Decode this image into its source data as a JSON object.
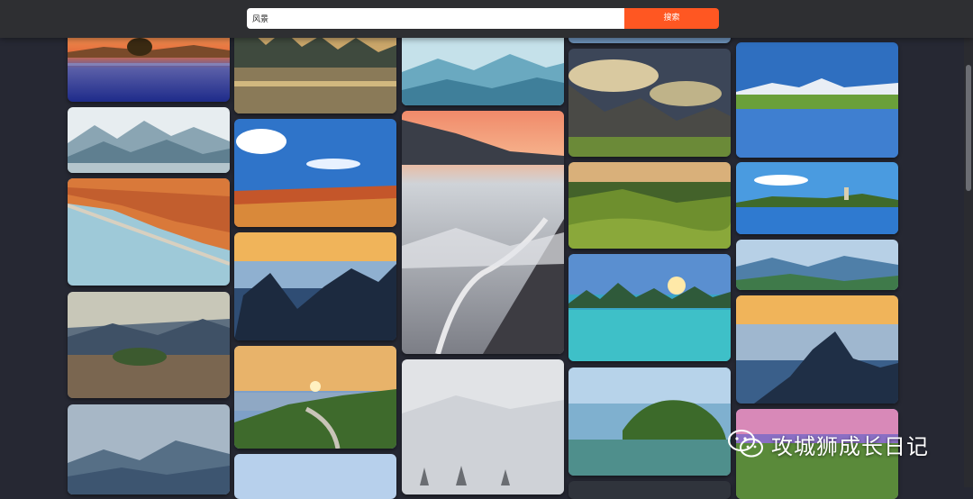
{
  "search": {
    "value": "风景",
    "button_label": "搜索"
  },
  "gallery": {
    "columns": [
      [
        {
          "name": "lake-sunset-tree"
        },
        {
          "name": "misty-mountains-blue"
        },
        {
          "name": "autumn-forest-lake"
        },
        {
          "name": "mountain-village-sunrays"
        },
        {
          "name": "blue-hazy-mountains"
        }
      ],
      [
        {
          "name": "karst-river-sunset"
        },
        {
          "name": "red-land-blue-sky"
        },
        {
          "name": "sea-of-clouds-peaks"
        },
        {
          "name": "sunset-coastline-road"
        },
        {
          "name": "light-sky-partial"
        }
      ],
      [
        {
          "name": "teal-misty-mountains"
        },
        {
          "name": "cloud-valley-winding-road"
        },
        {
          "name": "snowy-forest-fog"
        }
      ],
      [
        {
          "name": "blue-sky-partial"
        },
        {
          "name": "dramatic-clouds-grazing-cattle"
        },
        {
          "name": "green-terraces"
        },
        {
          "name": "karst-lake-sunset"
        },
        {
          "name": "green-karst-river"
        },
        {
          "name": "dark-partial"
        }
      ],
      [
        {
          "name": "alpine-lake-reflection"
        },
        {
          "name": "blue-lake-pagoda"
        },
        {
          "name": "blue-mountains-mist"
        },
        {
          "name": "sunrise-sea-of-clouds"
        },
        {
          "name": "purple-sunset-grassland"
        }
      ]
    ]
  },
  "watermark": {
    "text": "攻城狮成长日记",
    "icon": "wechat-icon"
  }
}
